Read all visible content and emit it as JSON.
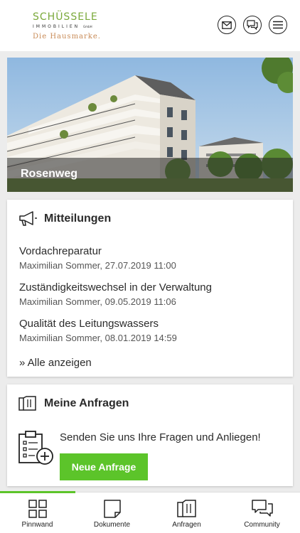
{
  "brand": {
    "name": "SCHÜSSELE",
    "sub": "IMMOBILIEN",
    "suffix": "GmbH",
    "tagline": "Die Hausmarke.",
    "green": "#7aa93a",
    "tag_color": "#c88a55"
  },
  "header": {
    "icons": [
      "mail-icon",
      "chat-icon",
      "menu-icon"
    ]
  },
  "hero": {
    "title": "Rosenweg"
  },
  "messages": {
    "title": "Mitteilungen",
    "items": [
      {
        "title": "Vordachreparatur",
        "meta": "Maximilian Sommer, 27.07.2019 11:00"
      },
      {
        "title": "Zuständigkeitswechsel in der Verwaltung",
        "meta": "Maximilian Sommer, 09.05.2019 11:06"
      },
      {
        "title": "Qualität des Leitungswassers",
        "meta": "Maximilian Sommer, 08.01.2019 14:59"
      }
    ],
    "show_all": "» Alle anzeigen"
  },
  "requests": {
    "title": "Meine Anfragen",
    "text": "Senden Sie uns Ihre Fragen und Anliegen!",
    "button": "Neue Anfrage",
    "accent": "#5cc42a"
  },
  "nav": {
    "active": "Pinnwand",
    "items": [
      {
        "label": "Pinnwand",
        "icon": "grid-icon"
      },
      {
        "label": "Dokumente",
        "icon": "document-icon"
      },
      {
        "label": "Anfragen",
        "icon": "folder-icon"
      },
      {
        "label": "Community",
        "icon": "chat-icon"
      }
    ]
  }
}
